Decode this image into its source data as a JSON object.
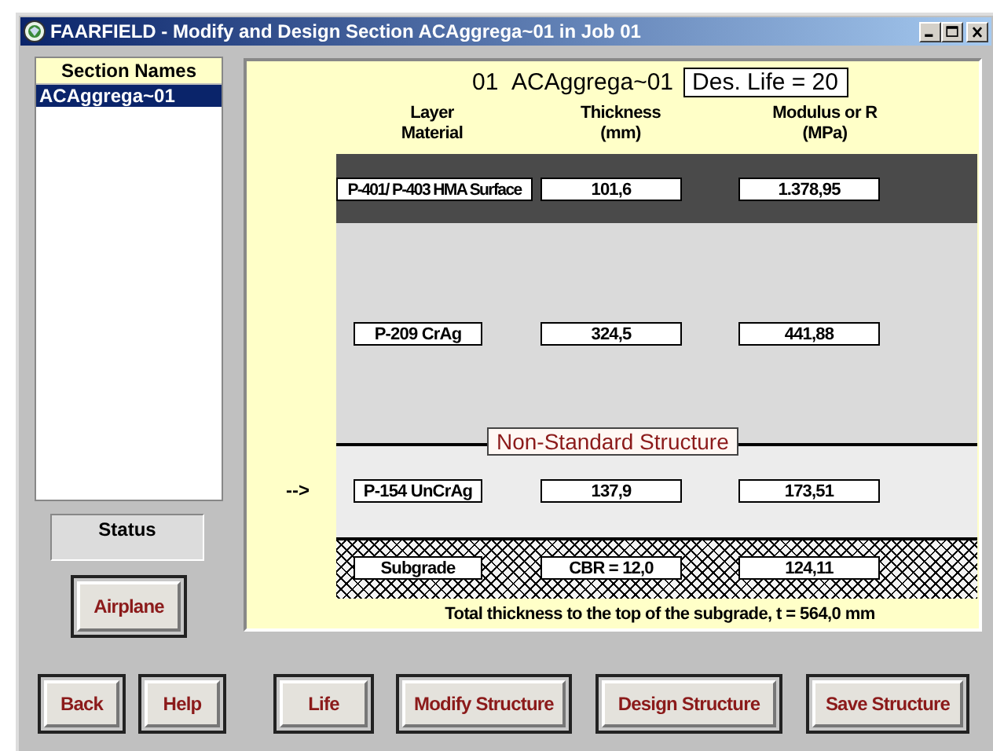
{
  "window": {
    "title": "FAARFIELD - Modify and Design Section ACAggrega~01 in Job 01"
  },
  "sections": {
    "header": "Section Names",
    "items": [
      {
        "label": "ACAggrega~01",
        "selected": true
      }
    ]
  },
  "status": {
    "label": "Status"
  },
  "airplane_button": "Airplane",
  "structure": {
    "job": "01",
    "section": "ACAggrega~01",
    "design_life": "Des. Life = 20",
    "columns": [
      {
        "lines": [
          "Layer",
          "Material"
        ]
      },
      {
        "lines": [
          "Thickness",
          "(mm)"
        ]
      },
      {
        "lines": [
          "Modulus or R",
          "(MPa)"
        ]
      }
    ],
    "layers": [
      {
        "kind": "surface",
        "material": "P-401/ P-403 HMA Surface",
        "thickness": "101,6",
        "modulus": "1.378,95"
      },
      {
        "kind": "base",
        "material": "P-209 CrAg",
        "thickness": "324,5",
        "modulus": "441,88"
      },
      {
        "kind": "subbase",
        "marker": "-->",
        "material": "P-154 UnCrAg",
        "thickness": "137,9",
        "modulus": "173,51"
      },
      {
        "kind": "subgrade",
        "material": "Subgrade",
        "thickness": "CBR = 12,0",
        "modulus": "124,11"
      }
    ],
    "notice": "Non-Standard Structure",
    "total": "Total thickness to the top of the subgrade, t = 564,0 mm"
  },
  "buttons": [
    "Back",
    "Help",
    "Life",
    "Modify Structure",
    "Design Structure",
    "Save Structure"
  ]
}
